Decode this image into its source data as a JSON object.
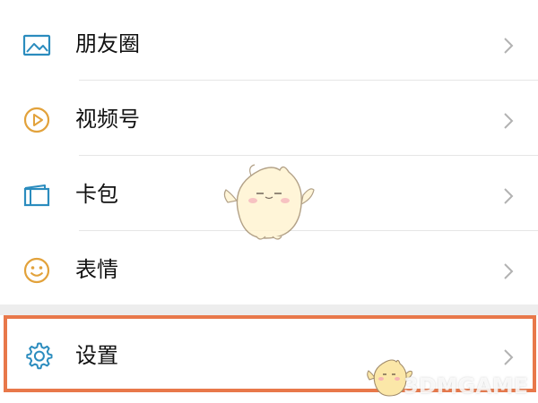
{
  "menu": {
    "items": [
      {
        "label": "朋友圈",
        "icon": "photo-icon",
        "color": "#2b8cbe"
      },
      {
        "label": "视频号",
        "icon": "play-circle-icon",
        "color": "#e2a23b"
      },
      {
        "label": "卡包",
        "icon": "card-wallet-icon",
        "color": "#2b8cbe"
      },
      {
        "label": "表情",
        "icon": "smiley-icon",
        "color": "#e2a23b"
      }
    ],
    "settings": {
      "label": "设置",
      "icon": "gear-icon",
      "color": "#2b8cbe"
    }
  },
  "highlight": {
    "color": "#e8784a"
  },
  "watermark": {
    "text": "3DMGAME"
  }
}
